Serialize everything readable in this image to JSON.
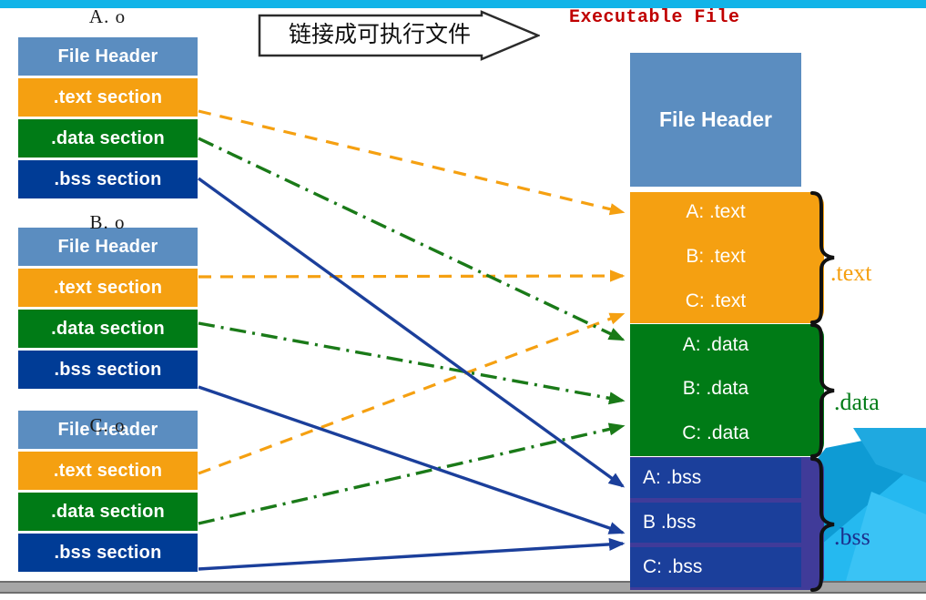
{
  "slide": {
    "exe_title": "Executable File",
    "banner_label": "链接成可执行文件",
    "colors": {
      "top_bar": "#12B4E8",
      "bottom_bar": "#A6A6A6",
      "header_blue": "#5B8DC0",
      "text_orange": "#F5A011",
      "data_green": "#007B16",
      "bss_navy": "#003C96",
      "bss_group_purple": "#403B99",
      "title_red": "#C00000"
    }
  },
  "object_files": [
    {
      "title": "A. o",
      "segments": [
        {
          "label": "File Header",
          "kind": "hdr"
        },
        {
          "label": ".text section",
          "kind": "text"
        },
        {
          "label": ".data section",
          "kind": "data"
        },
        {
          "label": ".bss section",
          "kind": "bss"
        }
      ]
    },
    {
      "title": "B. o",
      "segments": [
        {
          "label": "File Header",
          "kind": "hdr"
        },
        {
          "label": ".text section",
          "kind": "text"
        },
        {
          "label": ".data section",
          "kind": "data"
        },
        {
          "label": ".bss section",
          "kind": "bss"
        }
      ]
    },
    {
      "title": "C. o",
      "segments": [
        {
          "label": "File Header",
          "kind": "hdr"
        },
        {
          "label": ".text section",
          "kind": "text"
        },
        {
          "label": ".data section",
          "kind": "data"
        },
        {
          "label": ".bss section",
          "kind": "bss"
        }
      ]
    }
  ],
  "executable": {
    "header_label": "File Header",
    "segments": [
      {
        "label": "A: .text",
        "kind": "t",
        "align": "c"
      },
      {
        "label": "B: .text",
        "kind": "t",
        "align": "c"
      },
      {
        "label": "C: .text",
        "kind": "t",
        "align": "c"
      },
      {
        "label": "A: .data",
        "kind": "d",
        "align": "c"
      },
      {
        "label": "B: .data",
        "kind": "d",
        "align": "c"
      },
      {
        "label": "C: .data",
        "kind": "d",
        "align": "c"
      },
      {
        "label": "A: .bss",
        "kind": "b",
        "align": "l"
      },
      {
        "label": "B .bss",
        "kind": "b",
        "align": "l"
      },
      {
        "label": "C: .bss",
        "kind": "b",
        "align": "l"
      }
    ],
    "group_labels": {
      "text": ".text",
      "data": ".data",
      "bss": ".bss"
    }
  }
}
